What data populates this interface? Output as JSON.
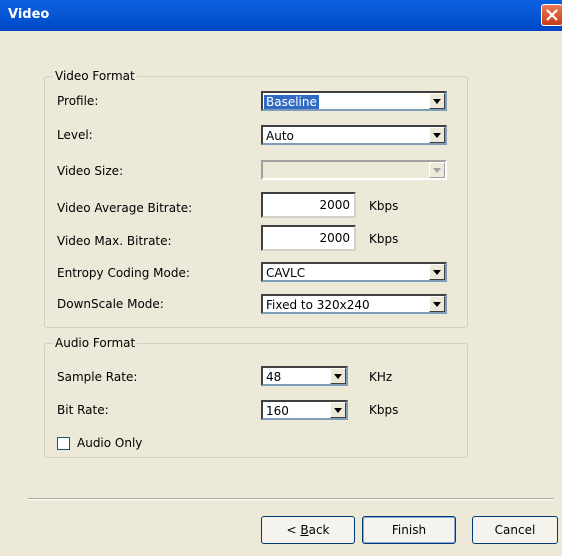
{
  "window": {
    "title": "Video"
  },
  "video_format": {
    "group_label": "Video Format",
    "profile": {
      "label": "Profile:",
      "value": "Baseline"
    },
    "level": {
      "label": "Level:",
      "value": "Auto"
    },
    "video_size": {
      "label": "Video Size:",
      "value": ""
    },
    "avg_bitrate": {
      "label": "Video Average Bitrate:",
      "value": "2000",
      "unit": "Kbps"
    },
    "max_bitrate": {
      "label": "Video Max. Bitrate:",
      "value": "2000",
      "unit": "Kbps"
    },
    "entropy": {
      "label": "Entropy Coding Mode:",
      "value": "CAVLC"
    },
    "downscale": {
      "label": "DownScale Mode:",
      "value": "Fixed to 320x240"
    }
  },
  "audio_format": {
    "group_label": "Audio Format",
    "sample_rate": {
      "label": "Sample Rate:",
      "value": "48",
      "unit": "KHz"
    },
    "bit_rate": {
      "label": "Bit Rate:",
      "value": "160",
      "unit": "Kbps"
    },
    "audio_only": {
      "label": "Audio Only",
      "checked": false
    }
  },
  "buttons": {
    "back_prefix": "< ",
    "back_accel": "B",
    "back_rest": "ack",
    "finish": "Finish",
    "cancel": "Cancel"
  }
}
